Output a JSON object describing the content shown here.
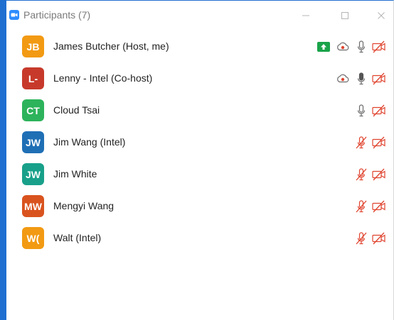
{
  "window": {
    "title": "Participants (7)",
    "minimize_icon": "minimize-icon",
    "maximize_icon": "maximize-icon",
    "close_icon": "close-icon",
    "accent_color": "#1f6fd1"
  },
  "participants": [
    {
      "initials": "JB",
      "name": "James Butcher (Host, me)",
      "avatar_color": "#f29a13",
      "share_screen": true,
      "recording": true,
      "mic": "on",
      "video": "off"
    },
    {
      "initials": "L-",
      "name": "Lenny - Intel (Co-host)",
      "avatar_color": "#c73a2b",
      "share_screen": false,
      "recording": true,
      "mic": "active",
      "video": "off"
    },
    {
      "initials": "CT",
      "name": "Cloud Tsai",
      "avatar_color": "#2db35b",
      "share_screen": false,
      "recording": false,
      "mic": "on",
      "video": "off"
    },
    {
      "initials": "JW",
      "name": "Jim Wang (Intel)",
      "avatar_color": "#1f6fb5",
      "share_screen": false,
      "recording": false,
      "mic": "muted",
      "video": "off"
    },
    {
      "initials": "JW",
      "name": "Jim White",
      "avatar_color": "#18a08a",
      "share_screen": false,
      "recording": false,
      "mic": "muted",
      "video": "off"
    },
    {
      "initials": "MW",
      "name": "Mengyi Wang",
      "avatar_color": "#d9531e",
      "share_screen": false,
      "recording": false,
      "mic": "muted",
      "video": "off"
    },
    {
      "initials": "W(",
      "name": "Walt (Intel)",
      "avatar_color": "#f29a13",
      "share_screen": false,
      "recording": false,
      "mic": "muted",
      "video": "off"
    }
  ],
  "colors": {
    "muted_red": "#e0442f",
    "share_green": "#1aa34a",
    "icon_gray": "#6b6b6b"
  }
}
